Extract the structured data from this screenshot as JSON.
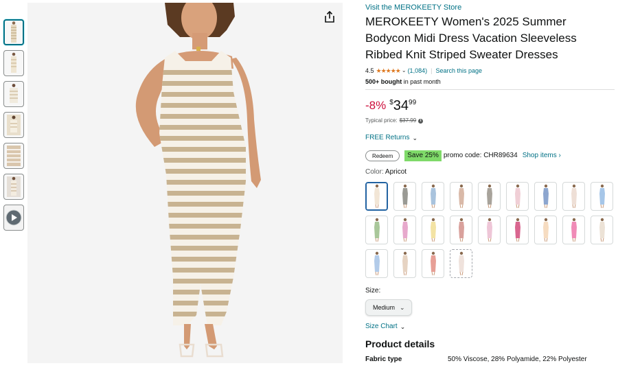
{
  "product": {
    "store_link": "Visit the MEROKEETY Store",
    "title": "MEROKEETY Women's 2025 Summer Bodycon Midi Dress Vacation Sleeveless Ribbed Knit Striped Sweater Dresses",
    "rating": "4.5",
    "stars": "★★★★★",
    "rating_count": "(1,084)",
    "search_page": "Search this page",
    "bought_bold": "500+ bought",
    "bought_rest": " in past month"
  },
  "price": {
    "discount": "-8%",
    "currency": "$",
    "whole": "34",
    "fraction": "99",
    "typical_label": "Typical price:",
    "typical_value": "$37.99"
  },
  "returns": {
    "label": "FREE Returns"
  },
  "coupon": {
    "redeem_label": "Redeem",
    "save_badge": "Save 25%",
    "promo_text": "promo code: CHR89634",
    "shop_items": "Shop items ›"
  },
  "color": {
    "label": "Color: ",
    "selected": "Apricot",
    "swatch_colors": [
      "#f2e6d6",
      "#9a9a94",
      "#a9c3dd",
      "#d9b9a8",
      "#a8a39b",
      "#f0cfd6",
      "#8da6cf",
      "#eedfd6",
      "#a6c6e8",
      "#a9c79a",
      "#e7a9cc",
      "#f3e3a4",
      "#d9a19c",
      "#eec6d7",
      "#d9668f",
      "#f6dcc1",
      "#f08bb7",
      "#ece2d6",
      "#b2cbe9",
      "#e6d3c2",
      "#e79f96",
      "#efe2dc"
    ],
    "selected_index": 0,
    "unavailable_index": 21
  },
  "size": {
    "label": "Size:",
    "selected": "Medium"
  },
  "size_chart": {
    "label": "Size Chart"
  },
  "details": {
    "heading": "Product details",
    "rows": [
      {
        "key": "Fabric type",
        "value": "50% Viscose, 28% Polyamide, 22% Polyester"
      }
    ]
  },
  "thumbnails": {
    "count": 7,
    "selected_index": 0
  },
  "colors": {
    "link": "#007185",
    "discount": "#cc0c39",
    "star": "#de7921",
    "save_badge": "#7fda69",
    "selected_border": "#2162a1"
  }
}
